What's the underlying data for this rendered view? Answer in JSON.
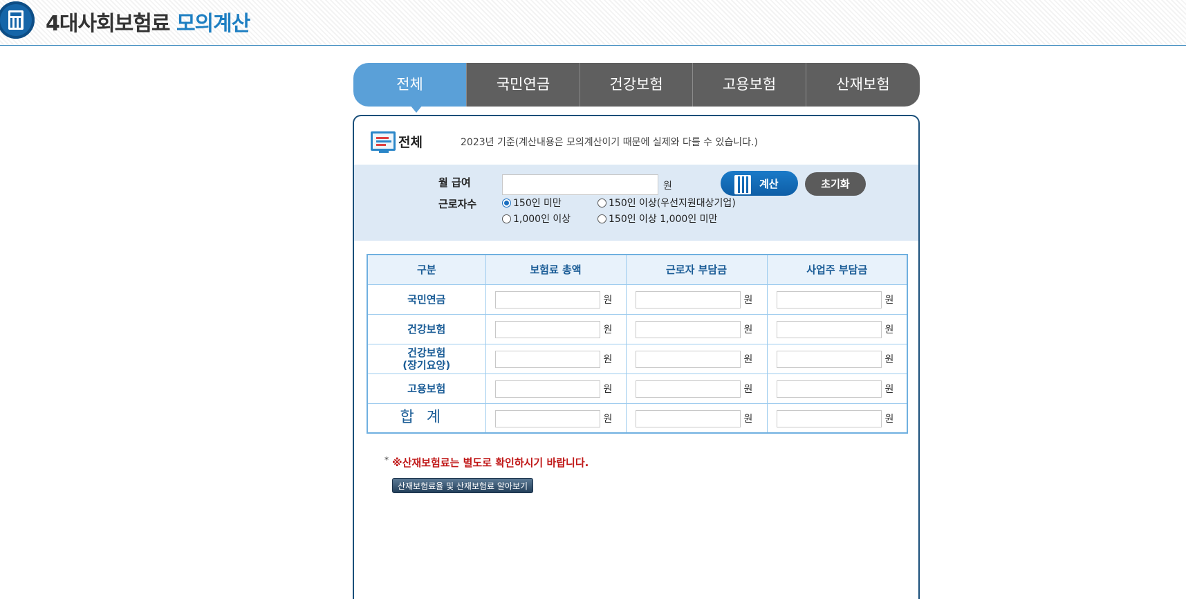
{
  "header": {
    "title_main": "4대사회보험료",
    "title_accent": "모의계산",
    "logo_icon": "calculator-icon"
  },
  "tabs": [
    {
      "label": "전체",
      "active": true
    },
    {
      "label": "국민연금",
      "active": false
    },
    {
      "label": "건강보험",
      "active": false
    },
    {
      "label": "고용보험",
      "active": false
    },
    {
      "label": "산재보험",
      "active": false
    }
  ],
  "panel": {
    "title": "전체",
    "icon": "document-list-icon",
    "note": "2023년 기준(계산내용은 모의계산이기 때문에 실제와 다를 수 있습니다.)"
  },
  "form": {
    "salary_label": "월 급여",
    "salary_value": "",
    "won": "원",
    "workers_label": "근로자수",
    "calc_button": "계산",
    "reset_button": "초기화",
    "workers_options": [
      {
        "label": "150인 미만",
        "selected": true
      },
      {
        "label": "150인 이상(우선지원대상기업)",
        "selected": false
      },
      {
        "label": "1,000인 이상",
        "selected": false
      },
      {
        "label": "150인 이상 1,000인 미만",
        "selected": false
      }
    ]
  },
  "table": {
    "headers": [
      "구분",
      "보험료 총액",
      "근로자 부담금",
      "사업주 부담금"
    ],
    "rows": [
      {
        "label": "국민연금",
        "label2": ""
      },
      {
        "label": "건강보험",
        "label2": ""
      },
      {
        "label": "건강보험",
        "label2": "(장기요양)"
      },
      {
        "label": "고용보험",
        "label2": ""
      },
      {
        "label": "합계",
        "label2": ""
      }
    ],
    "unit": "원"
  },
  "notice": {
    "mark": "*",
    "text": "※산재보험료는 별도로 확인하시기 바랍니다.",
    "link_button": "산재보험료율 및 산재보험료 알아보기"
  },
  "colors": {
    "accent": "#1e7fc2",
    "tab_active": "#5aa0d8",
    "tab_inactive": "#5f5f5f",
    "form_bg": "#dde9f5",
    "notice": "#c01818"
  }
}
